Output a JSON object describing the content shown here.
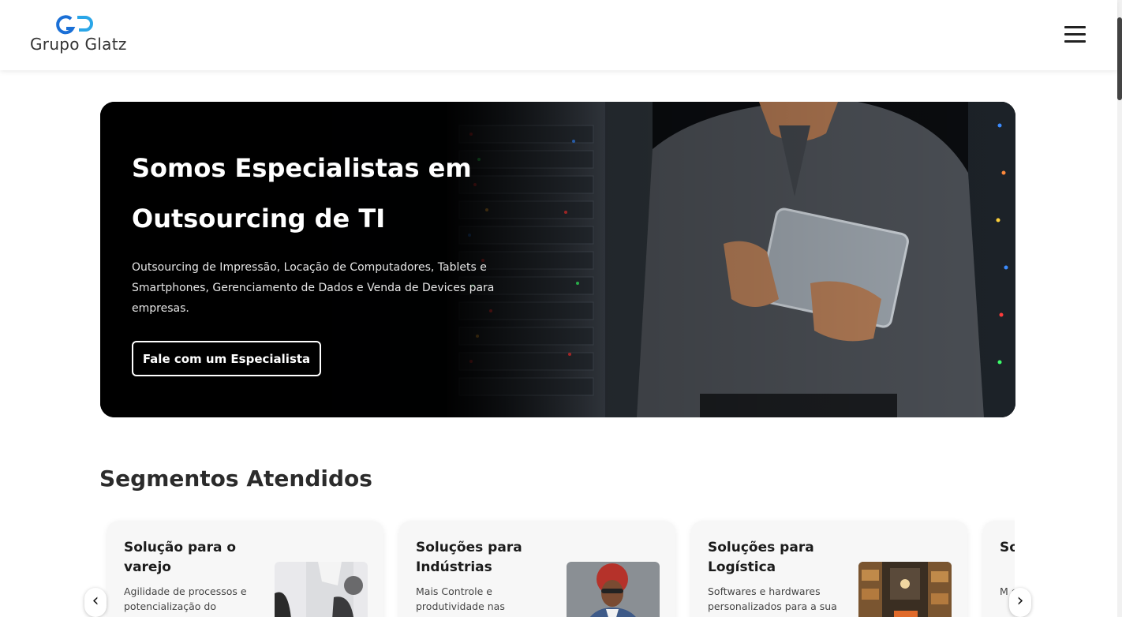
{
  "header": {
    "logo_text": "Grupo Glatz",
    "logo_mark": "GG",
    "menu_icon": "hamburger-menu-icon"
  },
  "hero": {
    "title": "Somos Especialistas em Outsourcing de TI",
    "description": "Outsourcing de Impressão, Locação de Computadores, Tablets e Smartphones, Gerenciamento de Dados e Venda de Devices para empresas.",
    "cta_label": "Fale com um Especialista"
  },
  "segments": {
    "title": "Segmentos Atendidos",
    "cards": [
      {
        "title": "Solução para o varejo",
        "description": "Agilidade de processos e potencialização do"
      },
      {
        "title": "Soluções para Indústrias",
        "description": "Mais Controle e produtividade nas"
      },
      {
        "title": "Soluções para Logística",
        "description": "Softwares e hardwares personalizados para a sua"
      },
      {
        "title": "So Sá",
        "description": "M efi"
      }
    ],
    "prev_arrow": "‹",
    "next_arrow": "›"
  },
  "colors": {
    "brand_blue": "#1a6fd6",
    "hero_bg": "#000000",
    "card_bg": "#f7f7f7"
  }
}
